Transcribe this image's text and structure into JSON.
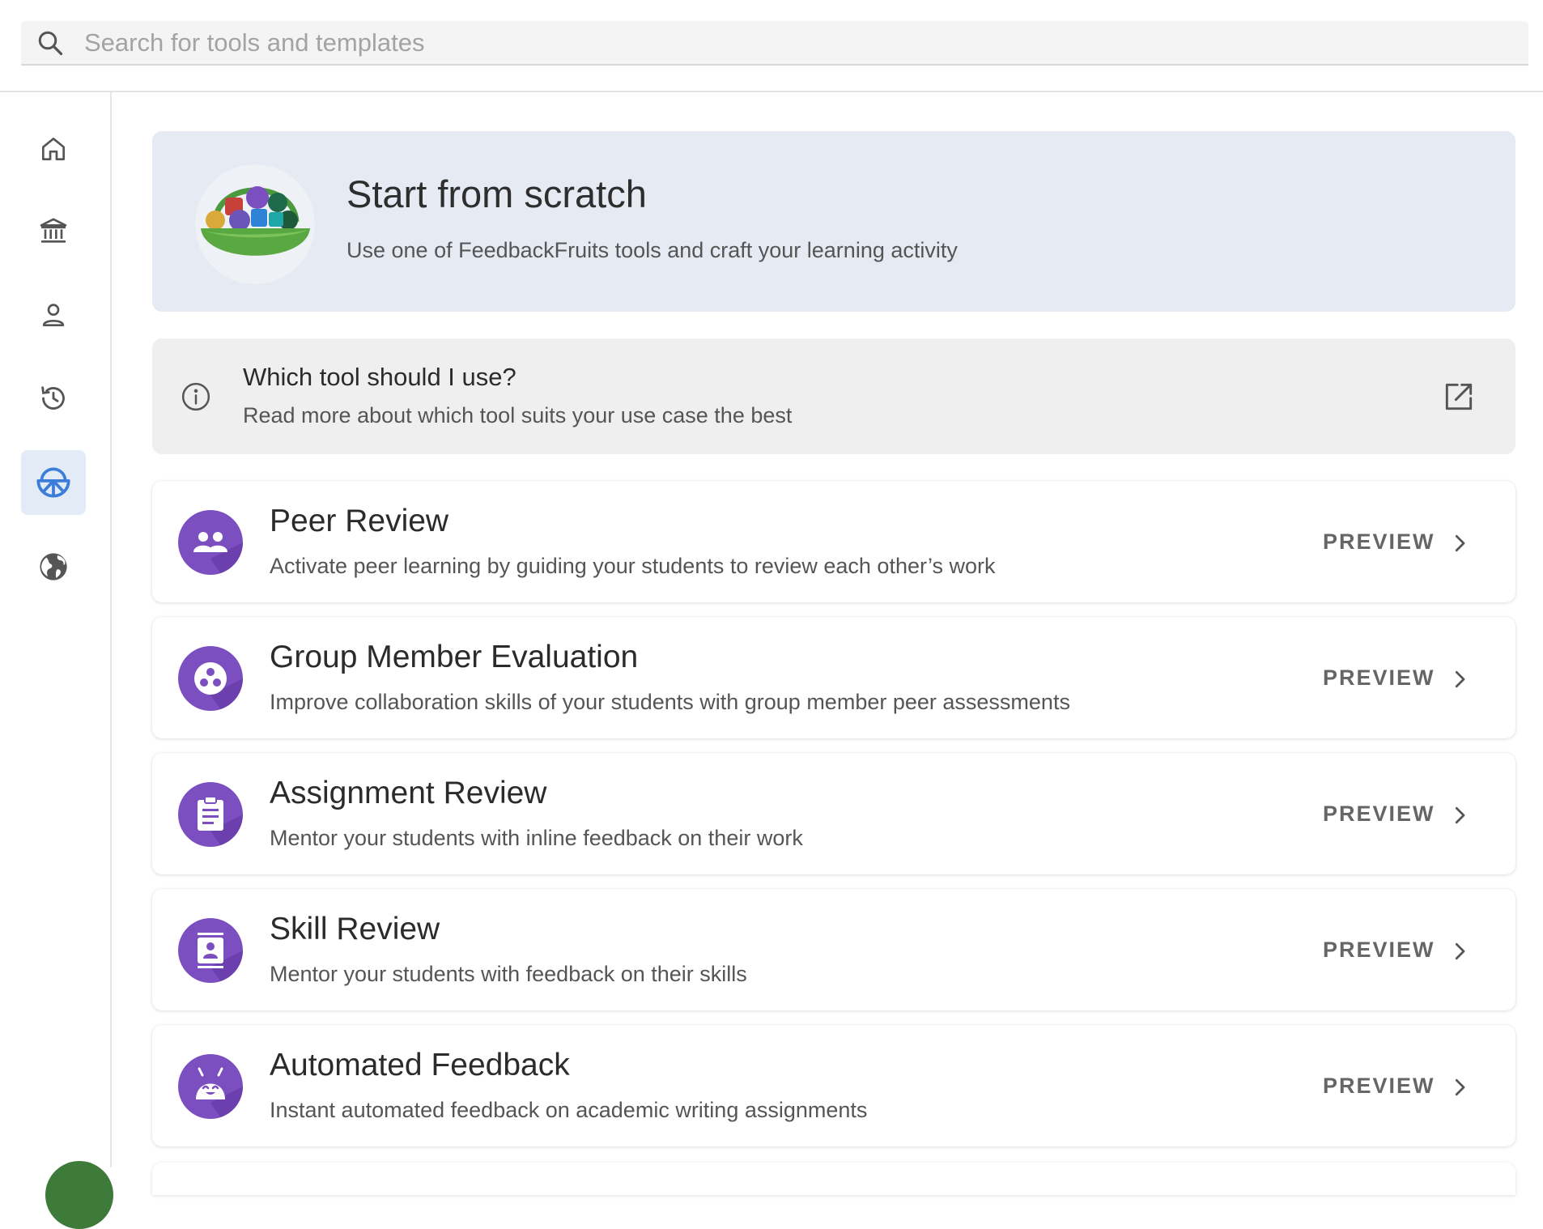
{
  "search": {
    "placeholder": "Search for tools and templates"
  },
  "hero": {
    "title": "Start from scratch",
    "subtitle": "Use one of FeedbackFruits tools and craft your learning activity"
  },
  "info": {
    "title": "Which tool should I use?",
    "subtitle": "Read more about which tool suits your use case the best"
  },
  "tools": [
    {
      "name": "Peer Review",
      "description": "Activate peer learning by guiding your students to review each other’s work",
      "preview_label": "PREVIEW",
      "icon": "peer-review-icon"
    },
    {
      "name": "Group Member Evaluation",
      "description": "Improve collaboration skills of your students with group member peer assessments",
      "preview_label": "PREVIEW",
      "icon": "group-member-evaluation-icon"
    },
    {
      "name": "Assignment Review",
      "description": "Mentor your students with inline feedback on their work",
      "preview_label": "PREVIEW",
      "icon": "assignment-review-icon"
    },
    {
      "name": "Skill Review",
      "description": "Mentor your students with feedback on their skills",
      "preview_label": "PREVIEW",
      "icon": "skill-review-icon"
    },
    {
      "name": "Automated Feedback",
      "description": "Instant automated feedback on academic writing assignments",
      "preview_label": "PREVIEW",
      "icon": "automated-feedback-icon"
    }
  ],
  "sidebar": {
    "items": [
      {
        "name": "home-icon"
      },
      {
        "name": "institution-icon"
      },
      {
        "name": "person-icon"
      },
      {
        "name": "history-icon"
      },
      {
        "name": "basket-icon",
        "active": true
      },
      {
        "name": "globe-icon"
      }
    ]
  },
  "colors": {
    "tool_icon": "#7b4fbf",
    "active_nav_bg": "#e3ebf7",
    "active_nav_icon": "#3b7dd8",
    "hero_bg": "#e5eaf3"
  }
}
